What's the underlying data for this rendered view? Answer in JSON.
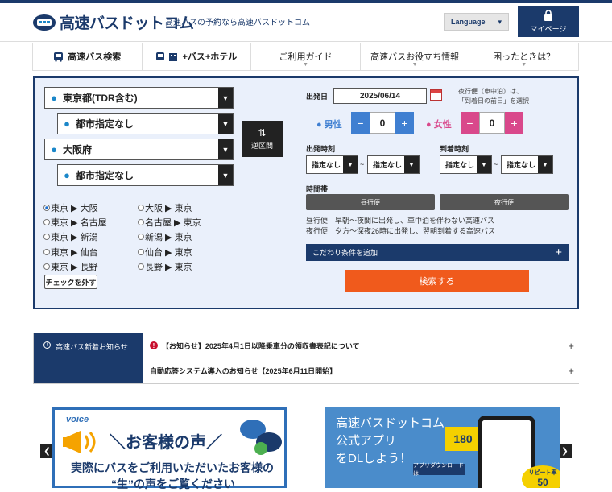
{
  "header": {
    "logo_text": "高速バスドットコム",
    "tagline": "高速バスの予約なら高速バスドットコム",
    "language_label": "Language",
    "mypage_label": "マイページ"
  },
  "nav": {
    "items": [
      {
        "label": "高速バス検索",
        "icon": "bus-icon"
      },
      {
        "label": "+バス+ホテル",
        "icon": "bus-hotel-icon"
      },
      {
        "label": "ご利用ガイド"
      },
      {
        "label": "高速バスお役立ち情報"
      },
      {
        "label": "困ったときは？"
      }
    ]
  },
  "search": {
    "from_pref": "東京都(TDR含む)",
    "from_city": "都市指定なし",
    "to_pref": "大阪府",
    "to_city": "都市指定なし",
    "swap_label": "逆区間",
    "routes": [
      {
        "label": "東京 ▶ 大阪",
        "checked": true
      },
      {
        "label": "大阪 ▶ 東京",
        "checked": false
      },
      {
        "label": "東京 ▶ 名古屋",
        "checked": false
      },
      {
        "label": "名古屋 ▶ 東京",
        "checked": false
      },
      {
        "label": "東京 ▶ 新潟",
        "checked": false
      },
      {
        "label": "新潟 ▶ 東京",
        "checked": false
      },
      {
        "label": "東京 ▶ 仙台",
        "checked": false
      },
      {
        "label": "仙台 ▶ 東京",
        "checked": false
      },
      {
        "label": "東京 ▶ 長野",
        "checked": false
      },
      {
        "label": "長野 ▶ 東京",
        "checked": false
      }
    ],
    "uncheck_label": "チェックを外す",
    "departure_date_label": "出発日",
    "departure_date": "2025/06/14",
    "night_note_1": "夜行便（車中泊）は、",
    "night_note_2": "「到着日の前日」を選択",
    "male_label": "男性",
    "male_count": "0",
    "female_label": "女性",
    "female_count": "0",
    "minus": "−",
    "plus": "+",
    "dep_time_label": "出発時刻",
    "arr_time_label": "到着時刻",
    "unspecified": "指定なし",
    "tilde": "~",
    "time_band_label": "時間帯",
    "day_bus": "昼行便",
    "night_bus": "夜行便",
    "day_desc_key": "昼行便",
    "day_desc": "早朝～夜間に出発し、車中泊を伴わない高速バス",
    "night_desc_key": "夜行便",
    "night_desc": "夕方～深夜26時に出発し、翌朝到着する高速バス",
    "more_conditions": "こだわり条件を追加",
    "search_button": "検索する"
  },
  "news": {
    "title": "高速バス新着お知らせ",
    "items": [
      "【お知らせ】2025年4月1日以降乗車分の領収書表記について",
      "自動応答システム導入のお知らせ【2025年6月11日開始】"
    ]
  },
  "banners": {
    "voice_tag": "voice",
    "voice_title": "お客様の声",
    "voice_text_1": "実際にバスをご利用いただいたお客様の",
    "voice_text_2": "“生”の声をご覧ください",
    "app_line_1": "高速バスドットコム",
    "app_line_2": "公式アプリ",
    "app_line_3": "をDLしよう！",
    "app_count": "180",
    "app_download": "アプリダウンロードは",
    "app_repeat": "リピート率",
    "app_repeat_value": "50"
  },
  "colors": {
    "navy": "#1b3a6b",
    "male": "#3f7fd1",
    "female": "#d9488b",
    "search": "#f05a1c"
  }
}
